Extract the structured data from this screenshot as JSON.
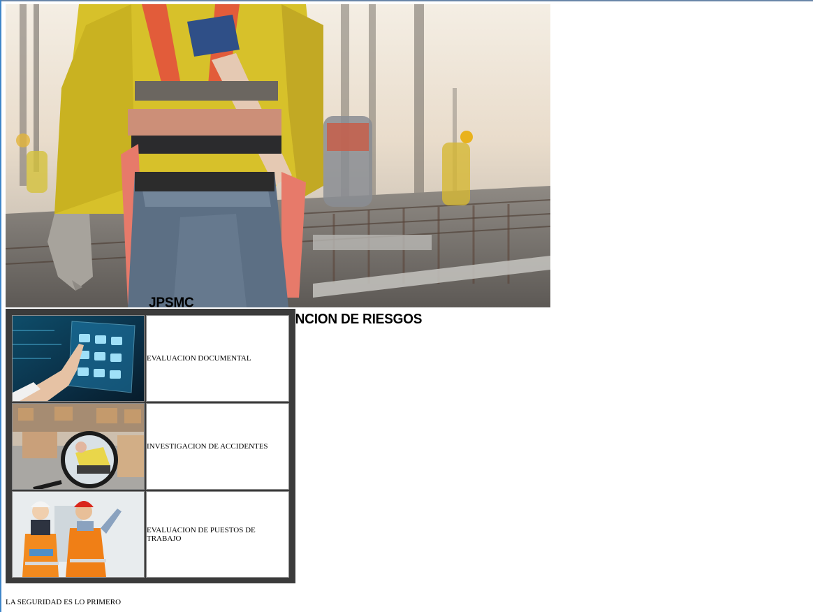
{
  "header": {
    "brand": "JPSMC",
    "tagline": "ASESORIAS EN PREVENCION DE RIESGOS"
  },
  "hero": {
    "image_subject": "construction-worker-safety-harness",
    "colors": {
      "shirt": "#d9c12e",
      "harness": "#e06a3a",
      "sky": "#efe6d8"
    }
  },
  "services": [
    {
      "label": "EVALUACION DOCUMENTAL",
      "image_subject": "touchscreen-documents"
    },
    {
      "label": "INVESTIGACION DE ACCIDENTES",
      "image_subject": "magnifier-accident"
    },
    {
      "label": "EVALUACION DE PUESTOS DE TRABAJO",
      "image_subject": "workers-with-helmets"
    }
  ],
  "footer": {
    "text": "LA SEGURIDAD ES LO PRIMERO"
  }
}
